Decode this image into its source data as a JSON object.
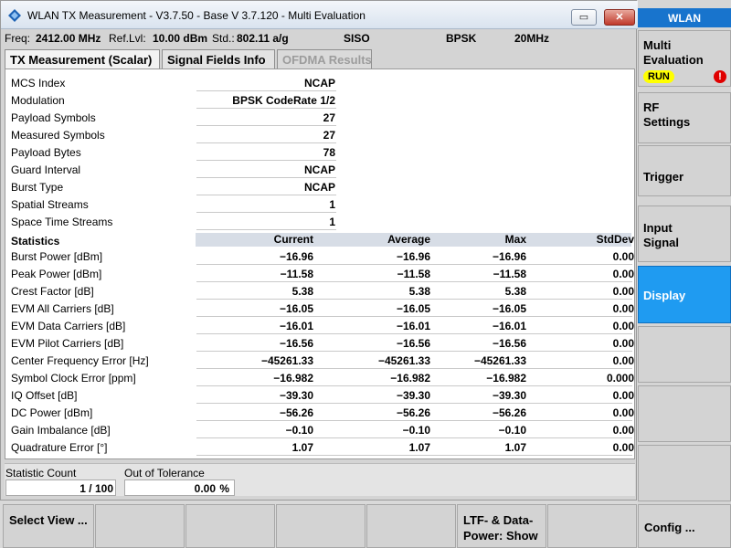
{
  "window": {
    "title": "WLAN TX Measurement  - V3.7.50 - Base V 3.7.120 - Multi Evaluation",
    "min_label": "▭",
    "max_label": "",
    "close_label": "✕"
  },
  "infobar": {
    "freq_label": "Freq:",
    "freq_value": "2412.00 MHz",
    "reflvl_label": "Ref.Lvl:",
    "reflvl_value": "10.00 dBm",
    "std_label": "Std.:",
    "std_value": "802.11 a/g",
    "mode": "SISO",
    "modulation": "BPSK",
    "bandwidth": "20MHz"
  },
  "tabs": [
    {
      "label": "TX Measurement (Scalar)",
      "state": "active"
    },
    {
      "label": "Signal Fields Info",
      "state": "normal"
    },
    {
      "label": "OFDMA Results",
      "state": "disabled"
    }
  ],
  "info_rows": [
    {
      "label": "MCS Index",
      "value": "NCAP"
    },
    {
      "label": "Modulation",
      "value": "BPSK CodeRate 1/2"
    },
    {
      "label": "Payload Symbols",
      "value": "27"
    },
    {
      "label": "Measured Symbols",
      "value": "27"
    },
    {
      "label": "Payload Bytes",
      "value": "78"
    },
    {
      "label": "Guard Interval",
      "value": "NCAP"
    },
    {
      "label": "Burst Type",
      "value": "NCAP"
    },
    {
      "label": "Spatial Streams",
      "value": "1"
    },
    {
      "label": "Space Time Streams",
      "value": "1"
    }
  ],
  "stats_header": {
    "label": "Statistics",
    "columns": [
      "Current",
      "Average",
      "Max",
      "StdDev"
    ]
  },
  "stats_rows": [
    {
      "label": "Burst Power [dBm]",
      "values": [
        "−16.96",
        "−16.96",
        "−16.96",
        "0.00"
      ]
    },
    {
      "label": "Peak Power [dBm]",
      "values": [
        "−11.58",
        "−11.58",
        "−11.58",
        "0.00"
      ]
    },
    {
      "label": "Crest Factor [dB]",
      "values": [
        "5.38",
        "5.38",
        "5.38",
        "0.00"
      ]
    },
    {
      "label": "EVM All Carriers [dB]",
      "values": [
        "−16.05",
        "−16.05",
        "−16.05",
        "0.00"
      ]
    },
    {
      "label": "EVM Data Carriers [dB]",
      "values": [
        "−16.01",
        "−16.01",
        "−16.01",
        "0.00"
      ]
    },
    {
      "label": "EVM Pilot Carriers [dB]",
      "values": [
        "−16.56",
        "−16.56",
        "−16.56",
        "0.00"
      ]
    },
    {
      "label": "Center Frequency Error [Hz]",
      "values": [
        "−45261.33",
        "−45261.33",
        "−45261.33",
        "0.00"
      ]
    },
    {
      "label": "Symbol Clock Error [ppm]",
      "values": [
        "−16.982",
        "−16.982",
        "−16.982",
        "0.000"
      ]
    },
    {
      "label": "IQ Offset [dB]",
      "values": [
        "−39.30",
        "−39.30",
        "−39.30",
        "0.00"
      ]
    },
    {
      "label": "DC Power [dBm]",
      "values": [
        "−56.26",
        "−56.26",
        "−56.26",
        "0.00"
      ]
    },
    {
      "label": "Gain Imbalance [dB]",
      "values": [
        "−0.10",
        "−0.10",
        "−0.10",
        "0.00"
      ]
    },
    {
      "label": "Quadrature Error [°]",
      "values": [
        "1.07",
        "1.07",
        "1.07",
        "0.00"
      ]
    }
  ],
  "bottom": {
    "statistic_count_label": "Statistic Count",
    "statistic_count_value": "1 / 100",
    "out_of_tolerance_label": "Out of Tolerance",
    "out_of_tolerance_value": "0.00",
    "out_of_tolerance_unit": "%"
  },
  "softkeys": {
    "select_view": "Select View ...",
    "ltf_data_power": "LTF- & Data-Power: Show",
    "config": "Config ..."
  },
  "sidebar": {
    "title": "WLAN",
    "multi_evaluation": "Multi Evaluation",
    "run_badge": "RUN",
    "alert_badge": "!",
    "rf_settings": "RF Settings",
    "trigger": "Trigger",
    "input_signal": "Input Signal",
    "display": "Display"
  },
  "colors": {
    "sidebar_title_bg": "#1874cd",
    "display_active_bg": "#1f9bf1",
    "run_badge_bg": "#ffff00",
    "alert_badge_bg": "#e00000",
    "header_row_bg": "#d7dde6"
  }
}
